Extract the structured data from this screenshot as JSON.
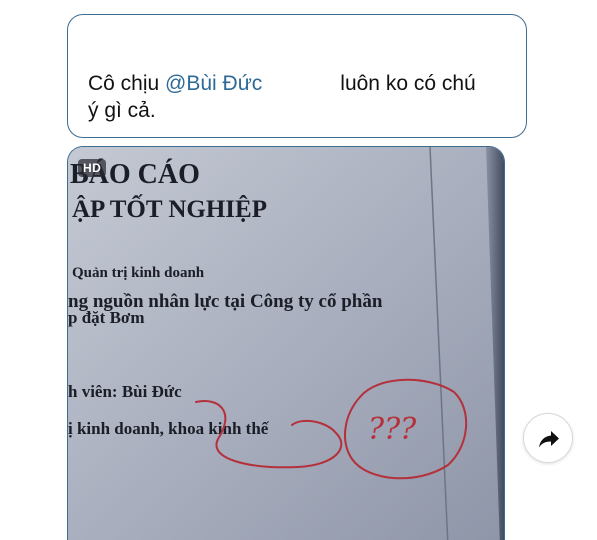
{
  "message": {
    "line1_before": "Cô chịu ",
    "mention": "@Bùi Đức",
    "line1_after": "luôn ko có chú",
    "line2": "ý gì cả."
  },
  "photo": {
    "badge": "HD",
    "document_text": {
      "title1": "BÁO CÁO",
      "title2": "ẬP TỐT NGHIỆP",
      "line_major": "Quản trị kinh doanh",
      "line_topic1": "ng nguồn nhân lực tại Công ty cổ phần",
      "line_topic2": "p đặt Bơm",
      "line_student": "h viên: Bùi Đức",
      "line_class": "ị kinh doanh, khoa kinh thế",
      "annotation": "???"
    }
  },
  "actions": {
    "share_icon": "share-arrow-icon"
  },
  "colors": {
    "bubble_border": "#3f6d92",
    "mention": "#2e6a95",
    "ink_red": "#b4303a",
    "paper": "#9fa6b7"
  }
}
